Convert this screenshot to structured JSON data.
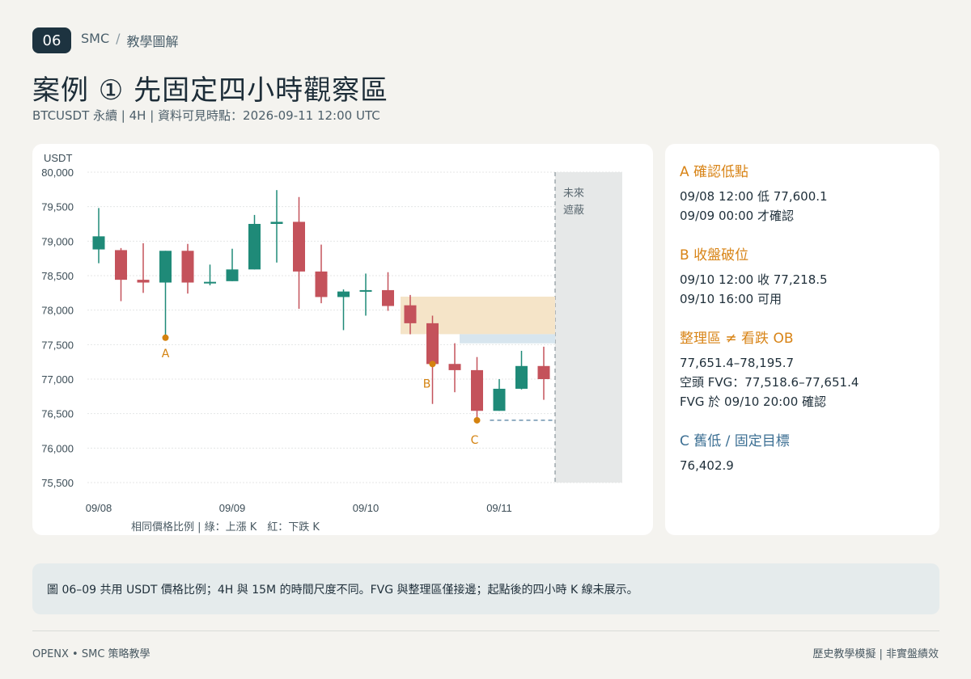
{
  "header": {
    "badge": "06",
    "crumb_1": "SMC",
    "crumb_sep": "/",
    "crumb_2": "教學圖解",
    "title": "案例 ① 先固定四小時觀察區",
    "subtitle": "BTCUSDT 永續 | 4H | 資料可見時點：2026-09-11 12:00 UTC"
  },
  "chart_data": {
    "type": "candlestick",
    "ylabel": "USDT",
    "ylim": [
      75500,
      80000
    ],
    "y_ticks": [
      "80,000",
      "79,500",
      "79,000",
      "78,500",
      "78,000",
      "77,500",
      "77,000",
      "76,500",
      "76,000",
      "75,500"
    ],
    "y_tick_values": [
      80000,
      79500,
      79000,
      78500,
      78000,
      77500,
      77000,
      76500,
      76000,
      75500
    ],
    "x_ticks": [
      "09/08",
      "09/09",
      "09/10",
      "09/11"
    ],
    "x_tick_index": [
      0,
      6,
      12,
      18
    ],
    "grid": true,
    "candles": [
      {
        "o": 78880,
        "h": 79480,
        "l": 78680,
        "c": 79070
      },
      {
        "o": 78870,
        "h": 78900,
        "l": 78130,
        "c": 78440
      },
      {
        "o": 78440,
        "h": 78970,
        "l": 78250,
        "c": 78400
      },
      {
        "o": 78400,
        "h": 78860,
        "l": 77600,
        "c": 78860
      },
      {
        "o": 78860,
        "h": 78960,
        "l": 78240,
        "c": 78400
      },
      {
        "o": 78400,
        "h": 78660,
        "l": 78360,
        "c": 78410
      },
      {
        "o": 78420,
        "h": 78890,
        "l": 78420,
        "c": 78590
      },
      {
        "o": 78590,
        "h": 79380,
        "l": 78590,
        "c": 79250
      },
      {
        "o": 79250,
        "h": 79740,
        "l": 78690,
        "c": 79280
      },
      {
        "o": 79280,
        "h": 79640,
        "l": 78020,
        "c": 78560
      },
      {
        "o": 78560,
        "h": 78950,
        "l": 78100,
        "c": 78190
      },
      {
        "o": 78190,
        "h": 78300,
        "l": 77710,
        "c": 78270
      },
      {
        "o": 78270,
        "h": 78530,
        "l": 77920,
        "c": 78290
      },
      {
        "o": 78290,
        "h": 78550,
        "l": 77990,
        "c": 78060
      },
      {
        "o": 78070,
        "h": 78220,
        "l": 77650,
        "c": 77810
      },
      {
        "o": 77810,
        "h": 77920,
        "l": 76640,
        "c": 77218.5
      },
      {
        "o": 77220,
        "h": 77520,
        "l": 76810,
        "c": 77130
      },
      {
        "o": 77130,
        "h": 77320,
        "l": 76402.9,
        "c": 76540
      },
      {
        "o": 76540,
        "h": 77000,
        "l": 76540,
        "c": 76860
      },
      {
        "o": 76860,
        "h": 77410,
        "l": 76850,
        "c": 77190
      },
      {
        "o": 77190,
        "h": 77470,
        "l": 76700,
        "c": 77000
      }
    ],
    "ob_zone": [
      77651.4,
      78195.7
    ],
    "fvg_zone": [
      77518.6,
      77651.4
    ],
    "target": 76402.9,
    "marker_a": {
      "index": 3,
      "price": 77600.1,
      "label": "A"
    },
    "marker_b": {
      "index": 15,
      "price": 77218.5,
      "label": "B"
    },
    "marker_c": {
      "index": 17,
      "price": 76402.9,
      "label": "C"
    },
    "future_mask_label_1": "未來",
    "future_mask_label_2": "遮蔽",
    "footnote": "相同價格比例 | 綠：上漲 K　紅：下跌 K",
    "colors": {
      "up": "#1f8a78",
      "down": "#c4525b",
      "marker": "#d4820f",
      "ob": "#f5e4c8",
      "fvg": "#d7e5ee",
      "future": "#e6e8e8",
      "grid": "#e4e6e6",
      "axis_text": "#3b4c56"
    }
  },
  "notes": {
    "a_title": "A 確認低點",
    "a_line_1": "09/08 12:00 低 77,600.1",
    "a_line_2": "09/09 00:00 才確認",
    "b_title": "B 收盤破位",
    "b_line_1": "09/10 12:00 收 77,218.5",
    "b_line_2": "09/10 16:00 可用",
    "ob_title": "整理區 ≠ 看跌 OB",
    "ob_line_1": "77,651.4–78,195.7",
    "ob_line_2": "空頭 FVG：77,518.6–77,651.4",
    "ob_line_3": "FVG 於 09/10 20:00 確認",
    "c_title": "C 舊低 / 固定目標",
    "c_line_1": "76,402.9"
  },
  "caption": "圖 06–09 共用 USDT 價格比例；4H 與 15M 的時間尺度不同。FVG 與整理區僅接邊；起點後的四小時 K 線未展示。",
  "footer": {
    "left": "OPENX • SMC 策略教學",
    "right": "歷史教學模擬 | 非實盤績效"
  }
}
